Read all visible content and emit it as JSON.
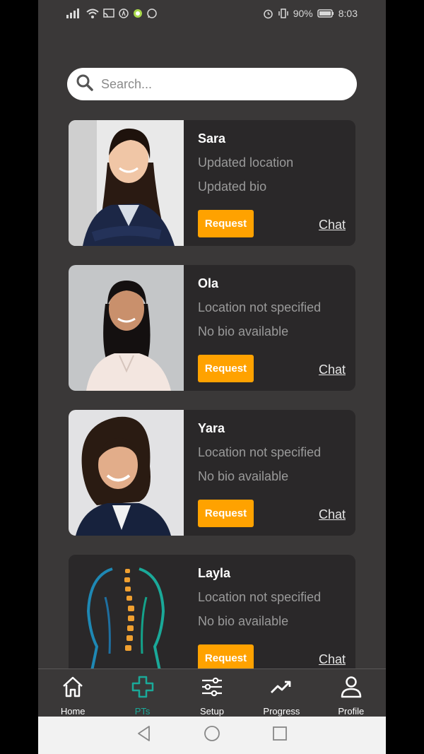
{
  "status": {
    "battery": "90%",
    "time": "8:03"
  },
  "search": {
    "placeholder": "Search..."
  },
  "therapists": [
    {
      "name": "Sara",
      "location": "Updated location",
      "bio": "Updated bio",
      "request_label": "Request",
      "chat_label": "Chat"
    },
    {
      "name": "Ola",
      "location": "Location not specified",
      "bio": "No bio available",
      "request_label": "Request",
      "chat_label": "Chat"
    },
    {
      "name": "Yara",
      "location": "Location not specified",
      "bio": "No bio available",
      "request_label": "Request",
      "chat_label": "Chat"
    },
    {
      "name": "Layla",
      "location": "Location not specified",
      "bio": "No bio available",
      "request_label": "Request",
      "chat_label": "Chat"
    }
  ],
  "tabs": [
    {
      "label": "Home",
      "icon": "home-icon",
      "active": false
    },
    {
      "label": "PTs",
      "icon": "medical-cross-icon",
      "active": true
    },
    {
      "label": "Setup",
      "icon": "sliders-icon",
      "active": false
    },
    {
      "label": "Progress",
      "icon": "trend-up-icon",
      "active": false
    },
    {
      "label": "Profile",
      "icon": "person-icon",
      "active": false
    }
  ],
  "colors": {
    "background": "#3a3838",
    "card": "#2a2829",
    "accent_button": "#ffa200",
    "active_tab": "#1aa999"
  }
}
